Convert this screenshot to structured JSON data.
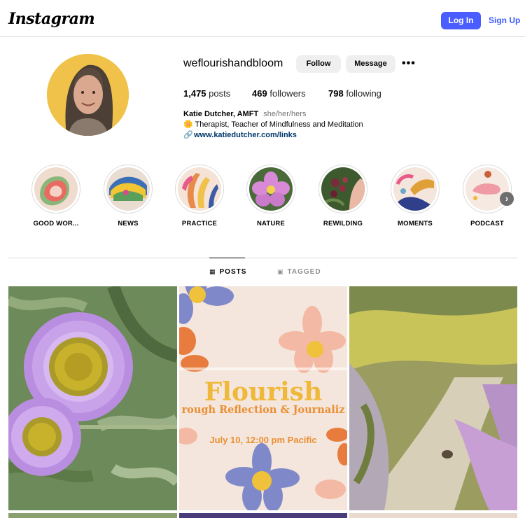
{
  "topbar": {
    "logo": "Instagram",
    "login_label": "Log In",
    "signup_label": "Sign Up"
  },
  "profile": {
    "username": "weflourishandbloom",
    "follow_label": "Follow",
    "message_label": "Message",
    "more_icon": "more-options-icon",
    "stats": {
      "posts_count": "1,475",
      "posts_label": "posts",
      "followers_count": "469",
      "followers_label": "followers",
      "following_count": "798",
      "following_label": "following"
    },
    "bio": {
      "name": "Katie Dutcher, AMFT",
      "pronouns": "she/her/hers",
      "line": "🌼 Therapist, Teacher of Mindfulness and Meditation",
      "link": "www.katiedutcher.com/links"
    }
  },
  "highlights": [
    {
      "label": "GOOD WOR..."
    },
    {
      "label": "NEWS"
    },
    {
      "label": "PRACTICE"
    },
    {
      "label": "NATURE"
    },
    {
      "label": "REWILDING"
    },
    {
      "label": "MOMENTS"
    },
    {
      "label": "PODCAST"
    }
  ],
  "tabs": {
    "posts": "POSTS",
    "tagged": "TAGGED"
  },
  "posts": {
    "p2_title": "Flourish",
    "p2_subtitle": "rough Reflection & Journaliz",
    "p2_date": "July 10, 12:00 pm Pacific"
  },
  "colors": {
    "accent": "#4a5dff",
    "link": "#00376b",
    "avatar_bg": "#f1c24a",
    "flyer_title": "#f0b83a",
    "flyer_text": "#ea8f33"
  }
}
